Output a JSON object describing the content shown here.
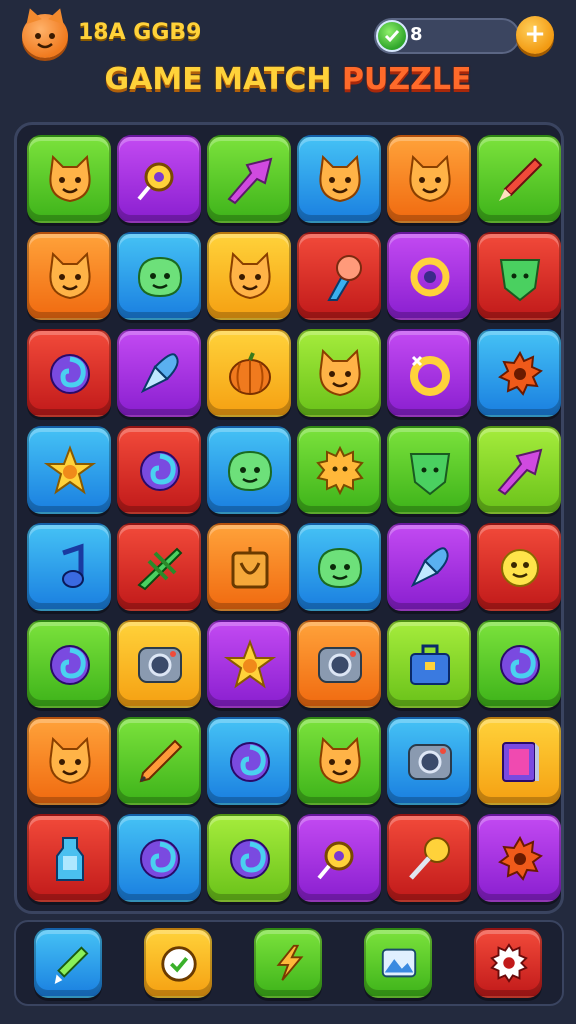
{
  "header": {
    "player_id": "18A GGB9",
    "coins": "8",
    "add_label": "+",
    "title_part1": "GAME MATCH",
    "title_part2": "PUZZLE"
  },
  "board": {
    "rows": [
      [
        {
          "color": "green",
          "icon": "cat-face-icon"
        },
        {
          "color": "purple",
          "icon": "pin-icon"
        },
        {
          "color": "green",
          "icon": "arrow-icon"
        },
        {
          "color": "blue",
          "icon": "cat-face-icon"
        },
        {
          "color": "orange",
          "icon": "cat-face-icon"
        },
        {
          "color": "green",
          "icon": "dart-icon"
        }
      ],
      [
        {
          "color": "orange",
          "icon": "cat-face-icon"
        },
        {
          "color": "blue",
          "icon": "blob-face-icon"
        },
        {
          "color": "yellow",
          "icon": "cat-face-icon"
        },
        {
          "color": "red",
          "icon": "brush-icon"
        },
        {
          "color": "purple",
          "icon": "gear-ring-icon"
        },
        {
          "color": "red",
          "icon": "shield-icon"
        }
      ],
      [
        {
          "color": "red",
          "icon": "swirl-icon"
        },
        {
          "color": "purple",
          "icon": "rocket-icon"
        },
        {
          "color": "yellow",
          "icon": "pumpkin-icon"
        },
        {
          "color": "lime",
          "icon": "cat-face-icon"
        },
        {
          "color": "purple",
          "icon": "ring-icon"
        },
        {
          "color": "blue",
          "icon": "cog-icon"
        }
      ],
      [
        {
          "color": "blue",
          "icon": "star-icon"
        },
        {
          "color": "red",
          "icon": "swirl-icon"
        },
        {
          "color": "blue",
          "icon": "blob-face-icon"
        },
        {
          "color": "green",
          "icon": "sun-icon"
        },
        {
          "color": "green",
          "icon": "shield-icon"
        },
        {
          "color": "lime",
          "icon": "arrow-icon"
        }
      ],
      [
        {
          "color": "blue",
          "icon": "note-icon"
        },
        {
          "color": "red",
          "icon": "plane-icon"
        },
        {
          "color": "orange",
          "icon": "box-icon"
        },
        {
          "color": "blue",
          "icon": "blob-face-icon"
        },
        {
          "color": "purple",
          "icon": "rocket-icon"
        },
        {
          "color": "red",
          "icon": "sun-face-icon"
        }
      ],
      [
        {
          "color": "green",
          "icon": "swirl-icon"
        },
        {
          "color": "yellow",
          "icon": "camera-icon"
        },
        {
          "color": "purple",
          "icon": "star-icon"
        },
        {
          "color": "orange",
          "icon": "camera-icon"
        },
        {
          "color": "lime",
          "icon": "bag-icon"
        },
        {
          "color": "green",
          "icon": "swirl-icon"
        }
      ],
      [
        {
          "color": "orange",
          "icon": "cat-face-icon"
        },
        {
          "color": "green",
          "icon": "pencil-icon"
        },
        {
          "color": "blue",
          "icon": "swirl-icon"
        },
        {
          "color": "green",
          "icon": "cat-face-icon"
        },
        {
          "color": "blue",
          "icon": "camera-icon"
        },
        {
          "color": "yellow",
          "icon": "book-icon"
        }
      ],
      [
        {
          "color": "red",
          "icon": "bottle-icon"
        },
        {
          "color": "blue",
          "icon": "swirl-icon"
        },
        {
          "color": "lime",
          "icon": "swirl-icon"
        },
        {
          "color": "purple",
          "icon": "pin-icon"
        },
        {
          "color": "red",
          "icon": "pushpin-icon"
        },
        {
          "color": "purple",
          "icon": "cog-icon"
        }
      ]
    ]
  },
  "toolbar": {
    "items": [
      {
        "color": "blue",
        "icon": "sword-icon"
      },
      {
        "color": "yellow",
        "icon": "timer-icon"
      },
      {
        "color": "green",
        "icon": "lightning-icon"
      },
      {
        "color": "green",
        "icon": "landscape-icon"
      },
      {
        "color": "red",
        "icon": "gear-icon"
      }
    ]
  }
}
